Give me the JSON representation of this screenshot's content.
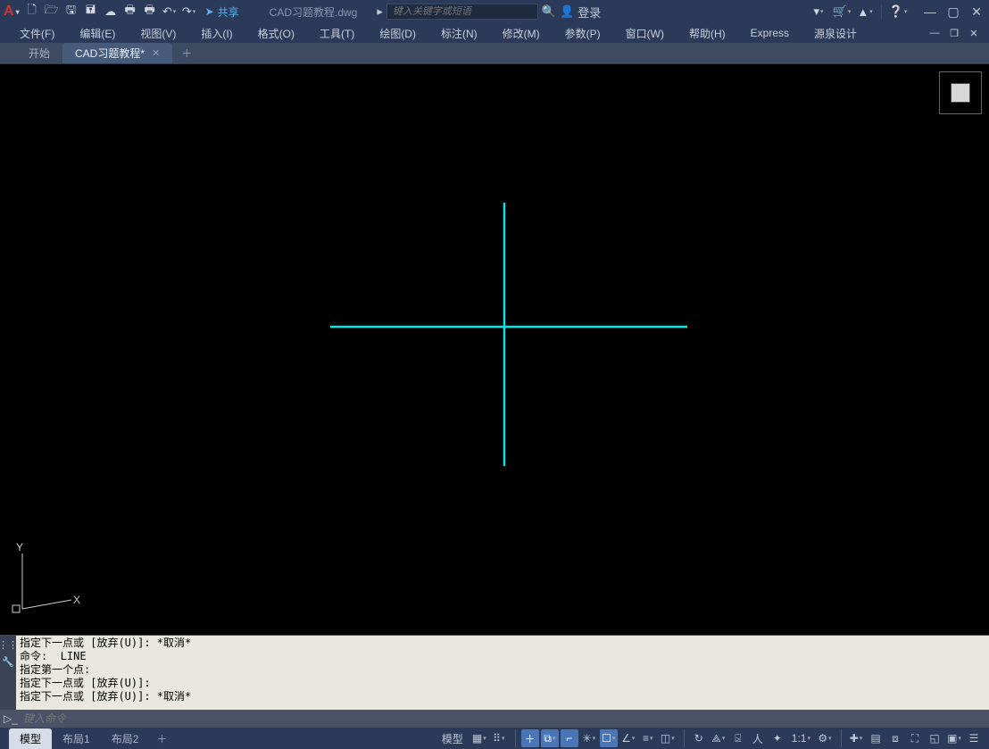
{
  "title": {
    "filename": "CAD习题教程.dwg",
    "share": "共享",
    "search_placeholder": "键入关键字或短语",
    "login": "登录"
  },
  "menu": {
    "file": "文件(F)",
    "edit": "编辑(E)",
    "view": "视图(V)",
    "insert": "插入(I)",
    "format": "格式(O)",
    "tools": "工具(T)",
    "draw": "绘图(D)",
    "dim": "标注(N)",
    "modify": "修改(M)",
    "param": "参数(P)",
    "window": "窗口(W)",
    "help": "帮助(H)",
    "express": "Express",
    "yuanquan": "源泉设计"
  },
  "tabs": {
    "start": "开始",
    "doc": "CAD习题教程*"
  },
  "cmd": {
    "history": "指定下一点或 [放弃(U)]: *取消*\n命令:  LINE\n指定第一个点:\n指定下一点或 [放弃(U)]:\n指定下一点或 [放弃(U)]: *取消*",
    "prompt_icon": "▷_",
    "input_placeholder": "键入命令"
  },
  "layout": {
    "model": "模型",
    "l1": "布局1",
    "l2": "布局2"
  },
  "status": {
    "model_btn": "模型",
    "scale": "1:1"
  }
}
